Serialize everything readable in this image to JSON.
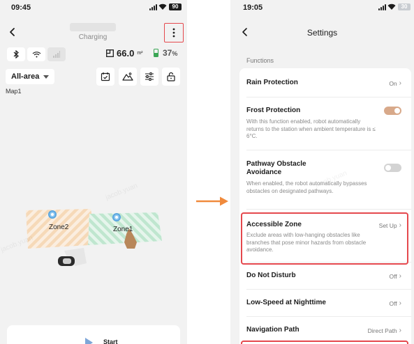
{
  "left_screen": {
    "status": {
      "time": "09:45",
      "battery": "90"
    },
    "header": {
      "subtitle": "Charging"
    },
    "stats": {
      "area_value": "66.0",
      "area_unit": "m²",
      "battery_value": "37",
      "battery_unit": "%"
    },
    "area_select": {
      "label": "All-area"
    },
    "map_name": "Map1",
    "zones": [
      {
        "name": "Zone2"
      },
      {
        "name": "Zone1"
      }
    ],
    "start_button": {
      "label": "Start"
    }
  },
  "right_screen": {
    "status": {
      "time": "19:05",
      "battery": "30"
    },
    "title": "Settings",
    "section_label": "Functions",
    "rows": [
      {
        "title": "Rain Protection",
        "value": "On"
      },
      {
        "title": "Frost Protection",
        "description": "With this function enabled, robot automatically returns to the station when ambient temperature is ≤ 6°C.",
        "toggle": "on"
      },
      {
        "title": "Pathway Obstacle Avoidance",
        "description": "When enabled, the robot automatically bypasses obstacles on designated pathways.",
        "toggle": "off"
      },
      {
        "title": "Accessible Zone",
        "description": "Exclude areas with low-hanging obstacles like branches that pose minor hazards from obstacle avoidance.",
        "value": "Set Up"
      },
      {
        "title": "Do Not Disturb",
        "value": "Off"
      },
      {
        "title": "Low-Speed at Nighttime",
        "value": "Off"
      },
      {
        "title": "Navigation Path",
        "value": "Direct Path"
      }
    ]
  },
  "watermark": "jacob.yuan",
  "colors": {
    "highlight_red": "#e5484d",
    "toggle_on": "#d8a98a",
    "arrow_orange": "#f08a3c",
    "zone2_stripe": "#f6d9b8",
    "zone1_stripe": "#bfe6cf"
  }
}
